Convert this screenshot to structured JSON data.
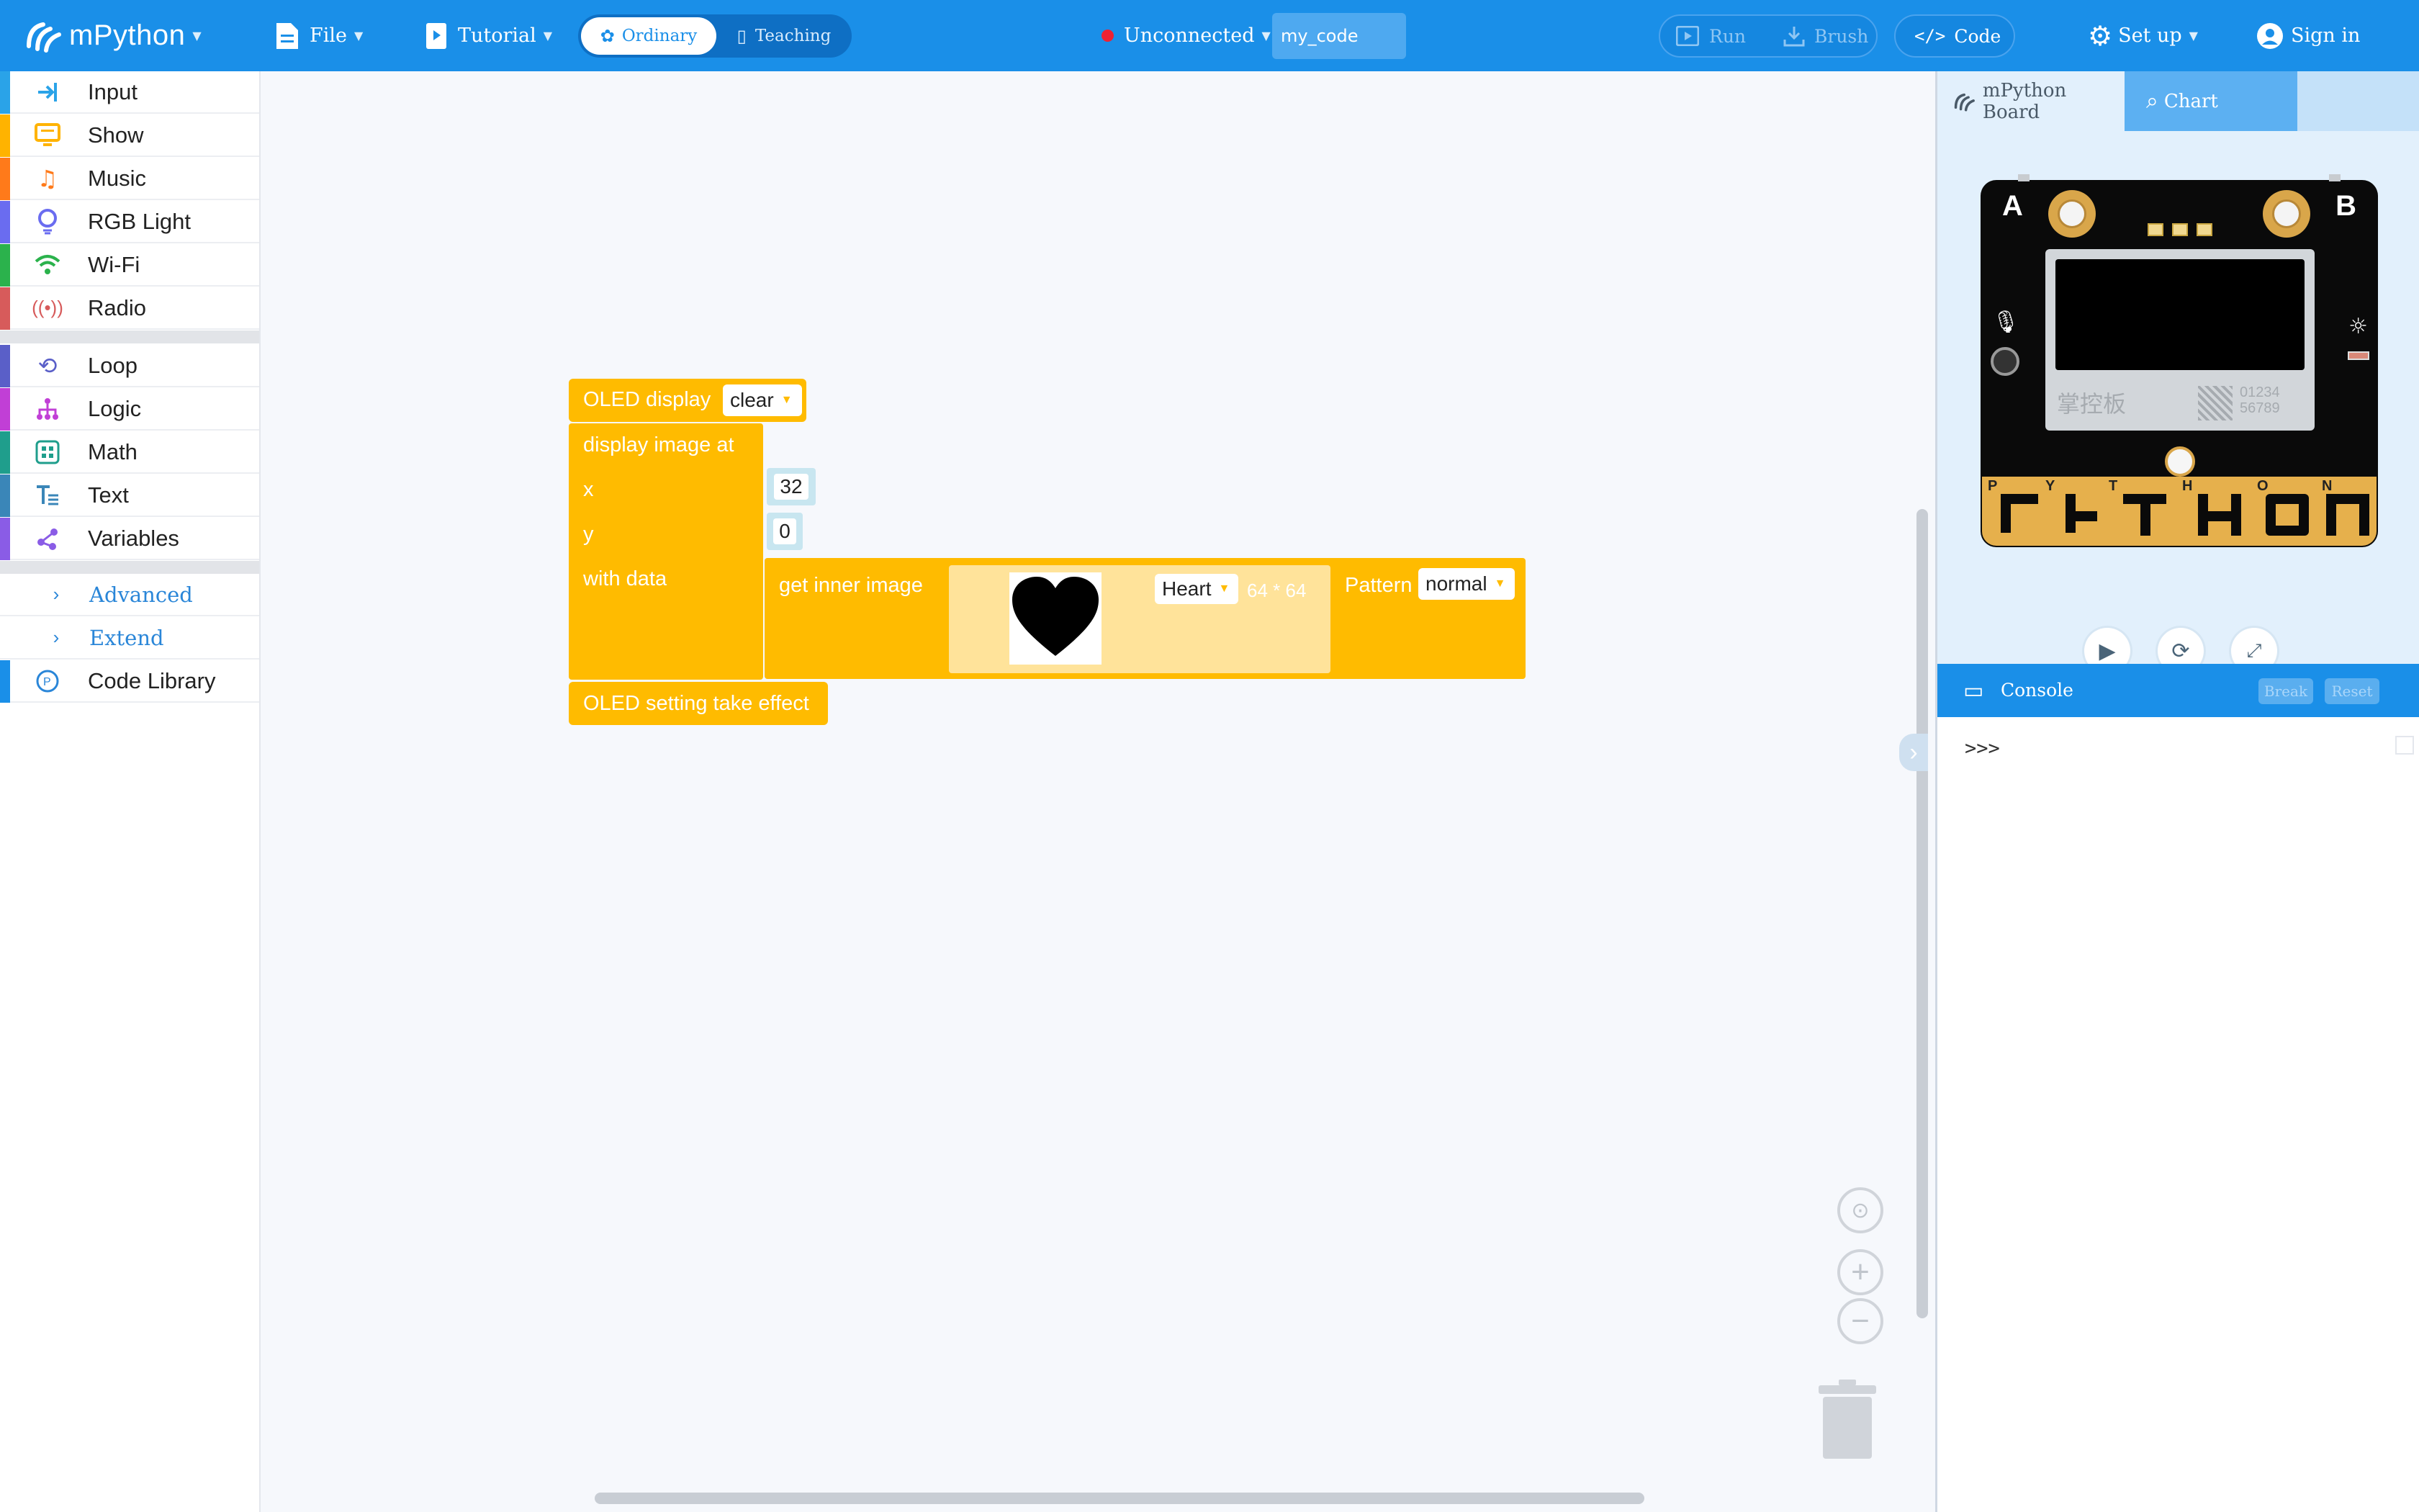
{
  "topbar": {
    "brand": "mPython",
    "file": "File",
    "tutorial": "Tutorial",
    "mode_ordinary": "Ordinary",
    "mode_teaching": "Teaching",
    "status": "Unconnected",
    "filename": "my_code",
    "run": "Run",
    "brush": "Brush",
    "code": "Code",
    "setup": "Set up",
    "signin": "Sign in"
  },
  "sidebar": {
    "items": [
      {
        "label": "Input",
        "color": "#2aa3e8",
        "icon": "input-icon"
      },
      {
        "label": "Show",
        "color": "#ffb300",
        "icon": "monitor-icon"
      },
      {
        "label": "Music",
        "color": "#ff7a1a",
        "icon": "music-note-icon"
      },
      {
        "label": "RGB Light",
        "color": "#6a6cf0",
        "icon": "lightbulb-icon"
      },
      {
        "label": "Wi-Fi",
        "color": "#2bb24c",
        "icon": "wifi-icon"
      },
      {
        "label": "Radio",
        "color": "#d75b5b",
        "icon": "radio-icon"
      },
      {
        "label": "Loop",
        "color": "#5a5fc8",
        "icon": "loop-icon"
      },
      {
        "label": "Logic",
        "color": "#c13fd6",
        "icon": "logic-icon"
      },
      {
        "label": "Math",
        "color": "#1f9e8c",
        "icon": "math-icon"
      },
      {
        "label": "Text",
        "color": "#3a86b8",
        "icon": "text-icon"
      },
      {
        "label": "Variables",
        "color": "#8a5ce6",
        "icon": "variables-icon"
      }
    ],
    "advanced": "Advanced",
    "extend": "Extend",
    "code_library": "Code Library"
  },
  "blocks": {
    "oled_display": "OLED display",
    "clear_option": "clear",
    "display_image_at": "display image at",
    "x_label": "x",
    "x_value": "32",
    "y_label": "y",
    "y_value": "0",
    "with_data": "with data",
    "get_inner_image": "get inner image",
    "image_option": "Heart",
    "image_size": "64 * 64",
    "pattern_label": "Pattern",
    "pattern_option": "normal",
    "take_effect": "OLED setting take effect"
  },
  "right_panel": {
    "tab_board": "mPython Board",
    "tab_chart": "Chart",
    "board": {
      "button_a": "A",
      "button_b": "B",
      "logo_text": "掌控板",
      "serial_line1": "01234",
      "serial_line2": "56789",
      "pins": [
        "P",
        "Y",
        "T",
        "H",
        "O",
        "N"
      ]
    },
    "console": "Console",
    "break": "Break",
    "reset": "Reset",
    "prompt": ">>>"
  },
  "colors": {
    "accent": "#1a8fe8",
    "block": "#ffbb00",
    "workspace": "#f6f8fc"
  }
}
